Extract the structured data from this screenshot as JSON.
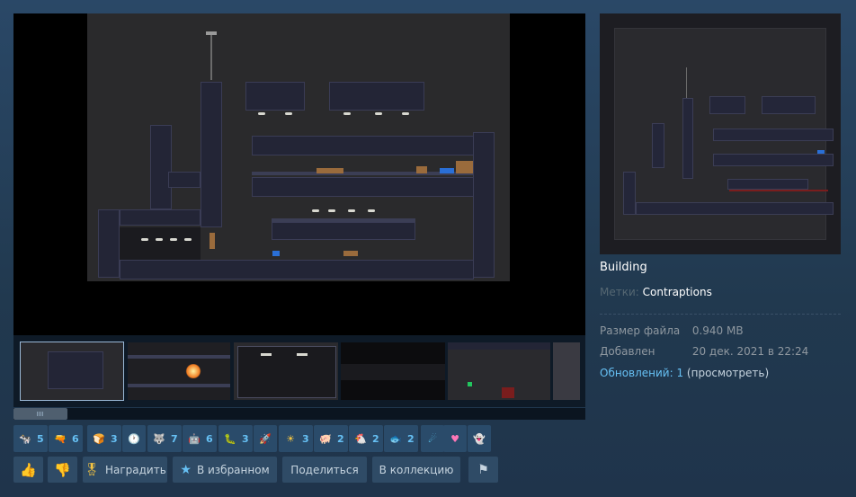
{
  "preview": {
    "title": "Building"
  },
  "tags": {
    "label": "Метки:",
    "value": "Contraptions"
  },
  "details": {
    "file_size_label": "Размер файла",
    "file_size_value": "0.940 MB",
    "added_label": "Добавлен",
    "added_value": "20 дек. 2021 в 22:24",
    "updates_label": "Обновлений: 1",
    "updates_link": "(просмотреть)"
  },
  "awards": [
    {
      "icon": "cow-icon",
      "glyph": "🐄",
      "color": "#e8e8e8",
      "count": "5"
    },
    {
      "icon": "gun-icon",
      "glyph": "🔫",
      "color": "#f0a030",
      "count": "6"
    },
    {
      "icon": "bread-icon",
      "glyph": "🍞",
      "color": "#f5d7a6",
      "count": "3"
    },
    {
      "icon": "clock-icon",
      "glyph": "🕐",
      "color": "#f3b04a",
      "count": ""
    },
    {
      "icon": "wolf-icon",
      "glyph": "🐺",
      "color": "#7fb6ff",
      "count": "7"
    },
    {
      "icon": "bot-icon",
      "glyph": "🤖",
      "color": "#ff7a2a",
      "count": "6"
    },
    {
      "icon": "bug-icon",
      "glyph": "🐛",
      "color": "#8cd0e6",
      "count": "3"
    },
    {
      "icon": "rocket-icon",
      "glyph": "🚀",
      "color": "#e23a3a",
      "count": ""
    },
    {
      "icon": "sun-icon",
      "glyph": "☀",
      "color": "#f5c542",
      "count": "3"
    },
    {
      "icon": "pig-icon",
      "glyph": "🐖",
      "color": "#ff7db3",
      "count": "2"
    },
    {
      "icon": "chicken-icon",
      "glyph": "🐔",
      "color": "#ff5555",
      "count": "2"
    },
    {
      "icon": "fish-icon",
      "glyph": "🐟",
      "color": "#ff7fae",
      "count": "2"
    },
    {
      "icon": "comet-icon",
      "glyph": "☄",
      "color": "#5fd3ff",
      "count": ""
    },
    {
      "icon": "heart-icon",
      "glyph": "♥",
      "color": "#ff77b7",
      "count": ""
    },
    {
      "icon": "ghost-icon",
      "glyph": "👻",
      "color": "#f1f1f1",
      "count": ""
    }
  ],
  "actions": {
    "award_label": "Наградить",
    "favorite_label": "В избранном",
    "share_label": "Поделиться",
    "collection_label": "В коллекцию"
  },
  "colors": {
    "accent_blue": "#66c0f4",
    "thumbs_up": "#a4d007",
    "background": "#1b2838"
  }
}
